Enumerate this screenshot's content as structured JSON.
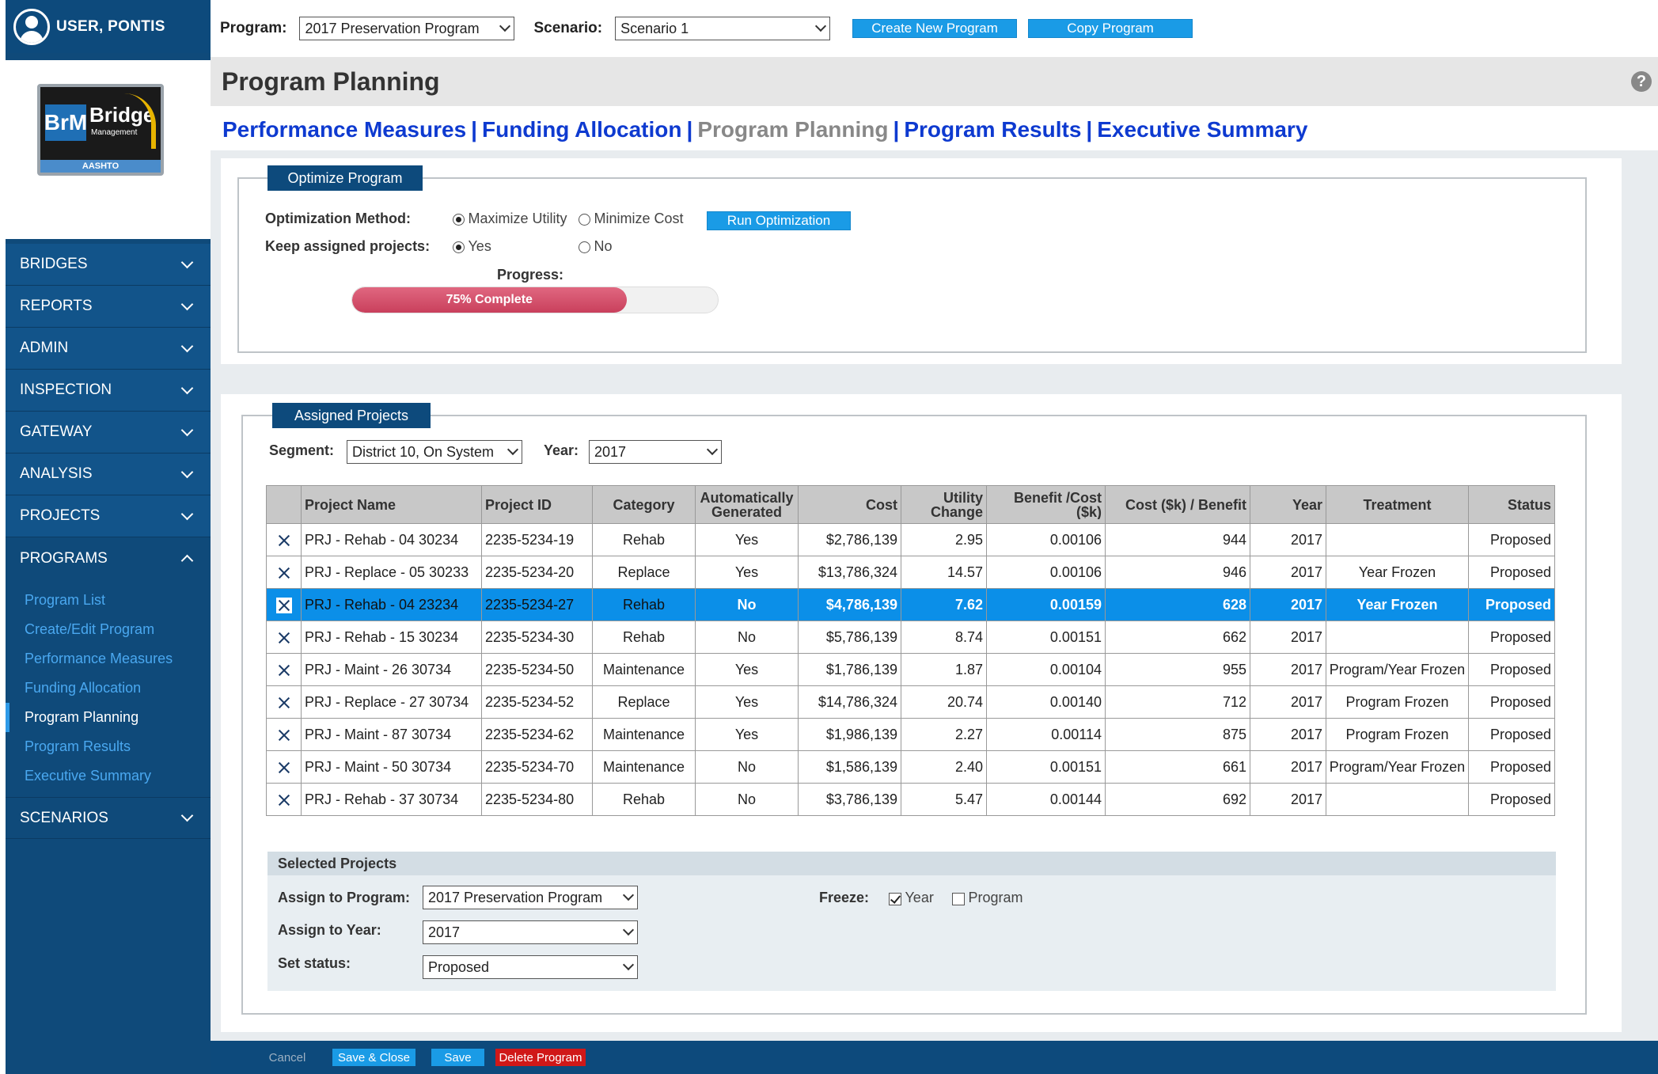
{
  "user": {
    "name": "USER, PONTIS"
  },
  "logo": {
    "brand_short": "BrM",
    "brand_name": "Bridge",
    "brand_sub": "Management",
    "org": "AASHTO"
  },
  "topbar": {
    "program_label": "Program:",
    "program_value": "2017 Preservation Program",
    "scenario_label": "Scenario:",
    "scenario_value": "Scenario 1",
    "create_btn": "Create New Program",
    "copy_btn": "Copy Program"
  },
  "sidebar": {
    "items": [
      {
        "label": "BRIDGES"
      },
      {
        "label": "REPORTS"
      },
      {
        "label": "ADMIN"
      },
      {
        "label": "INSPECTION"
      },
      {
        "label": "GATEWAY"
      },
      {
        "label": "ANALYSIS"
      },
      {
        "label": "PROJECTS"
      },
      {
        "label": "PROGRAMS"
      }
    ],
    "programs_sub": [
      {
        "label": "Program List"
      },
      {
        "label": "Create/Edit Program"
      },
      {
        "label": "Performance Measures"
      },
      {
        "label": "Funding Allocation"
      },
      {
        "label": "Program Planning"
      },
      {
        "label": "Program Results"
      },
      {
        "label": "Executive Summary"
      }
    ],
    "scenarios": "SCENARIOS"
  },
  "page": {
    "title": "Program Planning",
    "help": "?"
  },
  "tabs": [
    "Performance Measures",
    "Funding Allocation",
    "Program Planning",
    "Program Results",
    "Executive Summary"
  ],
  "optimize": {
    "legend": "Optimize Program",
    "method_label": "Optimization Method:",
    "method_opt1": "Maximize Utility",
    "method_opt2": "Minimize Cost",
    "run_btn": "Run Optimization",
    "keep_label": "Keep assigned projects:",
    "keep_yes": "Yes",
    "keep_no": "No",
    "progress_label": "Progress:",
    "progress_text": "75% Complete",
    "progress_value": 0.75
  },
  "assigned": {
    "legend": "Assigned Projects",
    "segment_label": "Segment:",
    "segment_value": "District 10, On System",
    "year_label": "Year:",
    "year_value": "2017",
    "columns": {
      "name": "Project Name",
      "id": "Project ID",
      "category": "Category",
      "auto_1": "Automatically",
      "auto_2": "Generated",
      "cost": "Cost",
      "utility_1": "Utility",
      "utility_2": "Change",
      "benefit_1": "Benefit /Cost",
      "benefit_2": "($k)",
      "costben": "Cost ($k) / Benefit",
      "year": "Year",
      "treatment": "Treatment",
      "status": "Status"
    },
    "rows": [
      {
        "name": "PRJ - Rehab - 04 30234",
        "id": "2235-5234-19",
        "category": "Rehab",
        "auto": "Yes",
        "cost": "$2,786,139",
        "utility": "2.95",
        "benefit": "0.00106",
        "costben": "944",
        "year": "2017",
        "treatment": "",
        "status": "Proposed"
      },
      {
        "name": "PRJ  - Replace - 05 30233",
        "id": "2235-5234-20",
        "category": "Replace",
        "auto": "Yes",
        "cost": "$13,786,324",
        "utility": "14.57",
        "benefit": "0.00106",
        "costben": "946",
        "year": "2017",
        "treatment": "Year Frozen",
        "status": "Proposed"
      },
      {
        "name": "PRJ - Rehab - 04 23234",
        "id": "2235-5234-27",
        "category": "Rehab",
        "auto": "No",
        "cost": "$4,786,139",
        "utility": "7.62",
        "benefit": "0.00159",
        "costben": "628",
        "year": "2017",
        "treatment": "Year Frozen",
        "status": "Proposed"
      },
      {
        "name": "PRJ - Rehab - 15 30234",
        "id": "2235-5234-30",
        "category": "Rehab",
        "auto": "No",
        "cost": "$5,786,139",
        "utility": "8.74",
        "benefit": "0.00151",
        "costben": "662",
        "year": "2017",
        "treatment": "",
        "status": "Proposed"
      },
      {
        "name": "PRJ - Maint - 26 30734",
        "id": "2235-5234-50",
        "category": "Maintenance",
        "auto": "Yes",
        "cost": "$1,786,139",
        "utility": "1.87",
        "benefit": "0.00104",
        "costben": "955",
        "year": "2017",
        "treatment": "Program/Year Frozen",
        "status": "Proposed"
      },
      {
        "name": "PRJ - Replace - 27 30734",
        "id": "2235-5234-52",
        "category": "Replace",
        "auto": "Yes",
        "cost": "$14,786,324",
        "utility": "20.74",
        "benefit": "0.00140",
        "costben": "712",
        "year": "2017",
        "treatment": "Program Frozen",
        "status": "Proposed"
      },
      {
        "name": "PRJ - Maint - 87 30734",
        "id": "2235-5234-62",
        "category": "Maintenance",
        "auto": "Yes",
        "cost": "$1,986,139",
        "utility": "2.27",
        "benefit": "0.00114",
        "costben": "875",
        "year": "2017",
        "treatment": "Program Frozen",
        "status": "Proposed"
      },
      {
        "name": "PRJ - Maint - 50 30734",
        "id": "2235-5234-70",
        "category": "Maintenance",
        "auto": "No",
        "cost": "$1,586,139",
        "utility": "2.40",
        "benefit": "0.00151",
        "costben": "661",
        "year": "2017",
        "treatment": "Program/Year Frozen",
        "status": "Proposed"
      },
      {
        "name": "PRJ - Rehab - 37 30734",
        "id": "2235-5234-80",
        "category": "Rehab",
        "auto": "No",
        "cost": "$3,786,139",
        "utility": "5.47",
        "benefit": "0.00144",
        "costben": "692",
        "year": "2017",
        "treatment": "",
        "status": "Proposed"
      }
    ]
  },
  "selected": {
    "header": "Selected Projects",
    "program_label": "Assign to Program:",
    "program_value": "2017 Preservation Program",
    "year_label": "Assign to Year:",
    "year_value": "2017",
    "status_label": "Set status:",
    "status_value": "Proposed",
    "freeze_label": "Freeze:",
    "freeze_year": "Year",
    "freeze_program": "Program"
  },
  "footer": {
    "cancel": "Cancel",
    "save_close": "Save & Close",
    "save": "Save",
    "delete": "Delete Program"
  },
  "colors": {
    "accent": "#1a9be6",
    "navy": "#0d4a7c",
    "selected_row": "#0b8fe8",
    "progress": "#d9506a",
    "delete": "#d01818"
  }
}
